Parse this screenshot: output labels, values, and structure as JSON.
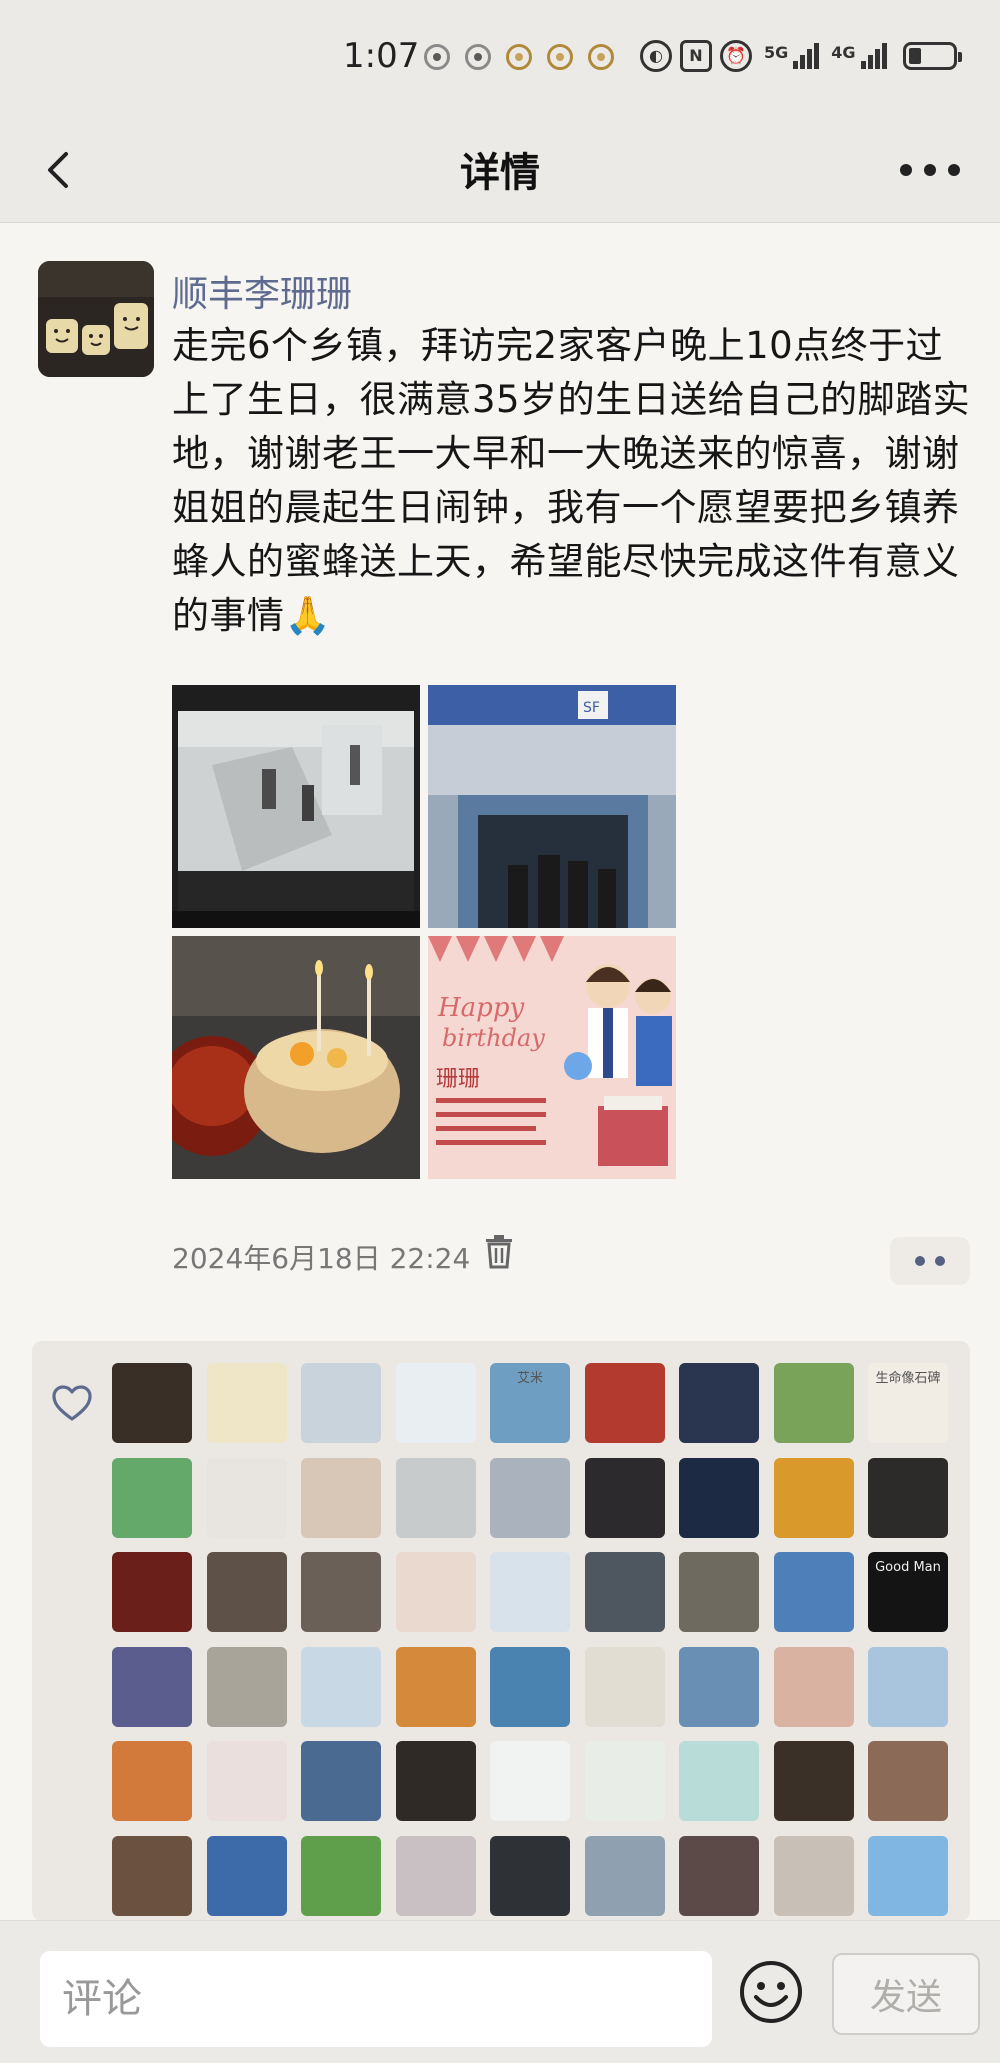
{
  "status_bar": {
    "time": "1:07",
    "net_labels": [
      "5G",
      "4G"
    ],
    "icons": [
      "app-notification-icon",
      "nfc-icon",
      "alarm-icon",
      "signal-icon",
      "battery-icon"
    ]
  },
  "header": {
    "title": "详情",
    "back_icon": "chevron-left-icon",
    "more_icon": "more-dots-icon"
  },
  "post": {
    "author": "顺丰李珊珊",
    "text": "走完6个乡镇，拜访完2家客户晚上10点终于过上了生日，很满意35岁的生日送给自己的脚踏实地，谢谢老王一大早和一大晚送来的惊喜，谢谢姐姐的晨起生日闹钟，我有一个愿望要把乡镇养蜂人的蜜蜂送上天，希望能尽快完成这件有意义的事情🙏",
    "photos": [
      {
        "name": "office-scene-photo"
      },
      {
        "name": "storefront-photo",
        "sign_text": "SF"
      },
      {
        "name": "birthday-cake-photo"
      },
      {
        "name": "birthday-card-photo",
        "card_text": "珊珊"
      }
    ],
    "timestamp": "2024年6月18日 22:24"
  },
  "likes": {
    "icon": "heart-icon",
    "count_rows": 6,
    "avatar_colors": [
      "#3a2f27",
      "#efe6c8",
      "#c9d3dc",
      "#e8eef2",
      "#6e9fc2",
      "#b23a2e",
      "#2a3550",
      "#7aa35a",
      "#f1ece4",
      "#64a86a",
      "#e8e4df",
      "#d8c6b6",
      "#c8cbcc",
      "#aab3bd",
      "#2c2a2c",
      "#1d2a44",
      "#d99a2b",
      "#2d2a2a",
      "#6a1f1a",
      "#5e5148",
      "#6a6058",
      "#ead9cf",
      "#d7e2ea",
      "#4e5660",
      "#6f6a60",
      "#4f7fb8",
      "#141414",
      "#5b5d8e",
      "#a9a49a",
      "#c9d8e5",
      "#d48a3a",
      "#4a82b0",
      "#e2ddd3",
      "#6a8fb5",
      "#d9b2a2",
      "#a8c5dd",
      "#d27a3c",
      "#eadfdd",
      "#4a6a92",
      "#2f2a26",
      "#f1f2f2",
      "#e9ede7",
      "#b8dcd8",
      "#3a3028",
      "#8c6a58",
      "#6b5240",
      "#3d6aa8",
      "#5f9e4b",
      "#c9c0c3",
      "#2e3236",
      "#8fa0b1",
      "#5b4a48",
      "#c8bfb6",
      "#7fb6e2"
    ],
    "avatar_labels": {
      "4": "艾米",
      "8": "生命像石碑",
      "26": "Good Man"
    }
  },
  "bottom_bar": {
    "comment_placeholder": "评论",
    "send_label": "发送",
    "emoji_icon": "emoji-icon"
  }
}
